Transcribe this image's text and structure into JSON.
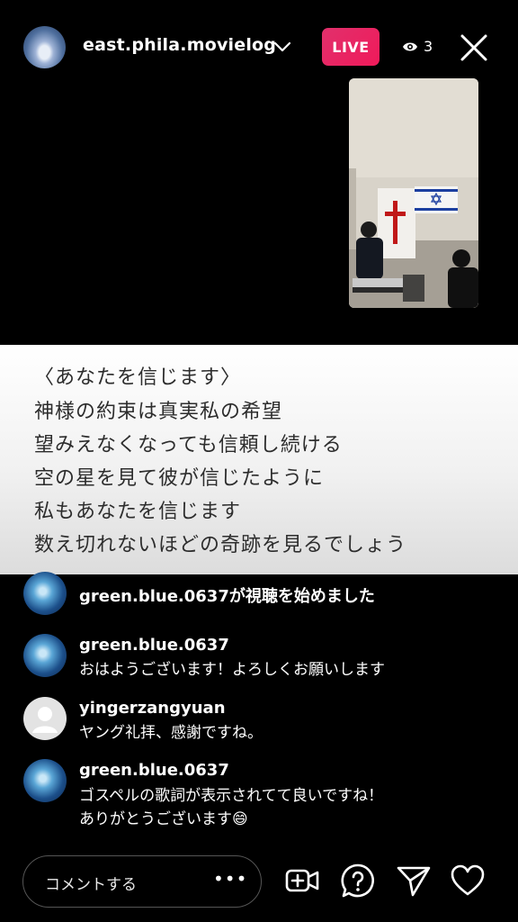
{
  "header": {
    "username": "east.phila.movielog",
    "live_label": "LIVE",
    "viewer_count": "3"
  },
  "lyrics": {
    "lines": [
      "〈あなたを信じます〉",
      "神様の約束は真実私の希望",
      "望みえなくなっても信頼し続ける",
      "空の星を見て彼が信じたように",
      "私もあなたを信じます",
      "数え切れないほどの奇跡を見るでしょう"
    ]
  },
  "comments": [
    {
      "username": "green.blue.0637が視聴を始めました",
      "text": ""
    },
    {
      "username": "green.blue.0637",
      "text": "おはようございます！よろしくお願いします"
    },
    {
      "username": "yingerzangyuan",
      "text": "ヤング礼拝、感謝ですね。"
    },
    {
      "username": "green.blue.0637",
      "text": "ゴスペルの歌詞が表示されてて良いですね！",
      "text2": "ありがとうございます😄"
    }
  ],
  "composer": {
    "placeholder": "コメントする",
    "more": "•••"
  },
  "colors": {
    "live_badge": "#e1306c",
    "background": "#000000"
  },
  "icons": [
    "chevron-down-icon",
    "eye-icon",
    "close-icon",
    "add-guest-icon",
    "question-icon",
    "send-icon",
    "heart-icon"
  ]
}
